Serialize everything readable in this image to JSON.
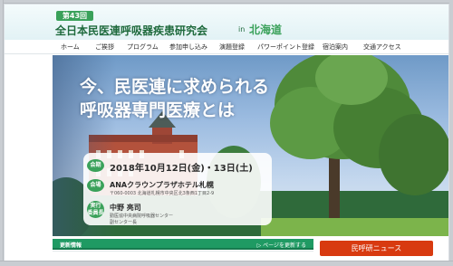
{
  "header": {
    "badge": "第43回",
    "title": "全日本民医連呼吸器疾患研究会",
    "title_in": "in",
    "title_place": "北海道"
  },
  "nav": {
    "items": [
      "ホーム",
      "ご挨拶",
      "プログラム",
      "参加申し込み",
      "演題登録",
      "パワーポイント登録",
      "宿泊案内",
      "交通アクセス"
    ]
  },
  "hero": {
    "headline_line1": "今、民医連に求められる",
    "headline_line2": "呼吸器専門医療とは",
    "date_tag": "会期",
    "date": "2018年10月12日(金)・13日(土)",
    "venue_tag": "会場",
    "venue": "ANAクラウンプラザホテル札幌",
    "address": "〒060-0003 北海道札幌市中央区北3条西1丁目2-9",
    "chair_tag_line1": "実行",
    "chair_tag_line2": "委員長",
    "chair": "中野 亮司",
    "chair_aff_line1": "勤医協中央病院呼吸器センター",
    "chair_aff_line2": "副センター長"
  },
  "news": {
    "label": "更新情報",
    "link": "ページを更新する"
  },
  "red_button": "民呼研ニュース",
  "colors": {
    "accent_green": "#3aa15a",
    "title_green": "#1f6a3d",
    "news_green": "#1f9a63",
    "button_red": "#d83a10"
  }
}
